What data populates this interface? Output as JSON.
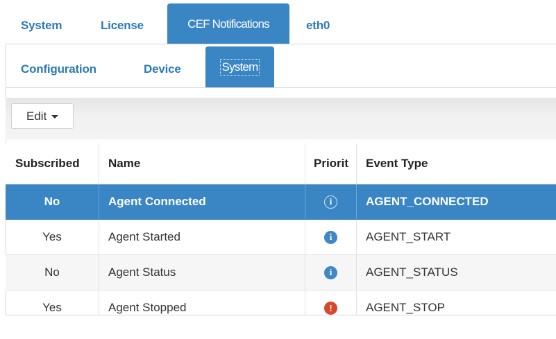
{
  "top_tabs": [
    {
      "label": "System",
      "active": false
    },
    {
      "label": "License",
      "active": false
    },
    {
      "label": "CEF Notifications",
      "active": true
    },
    {
      "label": "eth0",
      "active": false
    }
  ],
  "sub_tabs": [
    {
      "label": "Configuration",
      "active": false
    },
    {
      "label": "Device",
      "active": false
    },
    {
      "label": "System",
      "active": true
    }
  ],
  "toolbar": {
    "edit_label": "Edit"
  },
  "table": {
    "columns": [
      "Subscribed",
      "Name",
      "Priorit",
      "Event Type"
    ],
    "rows": [
      {
        "subscribed": "No",
        "name": "Agent Connected",
        "priority_icon": "info-icon",
        "event_type": "AGENT_CONNECTED",
        "selected": true
      },
      {
        "subscribed": "Yes",
        "name": "Agent Started",
        "priority_icon": "info-icon",
        "event_type": "AGENT_START",
        "selected": false
      },
      {
        "subscribed": "No",
        "name": "Agent Status",
        "priority_icon": "info-icon",
        "event_type": "AGENT_STATUS",
        "selected": false
      },
      {
        "subscribed": "Yes",
        "name": "Agent Stopped",
        "priority_icon": "error-icon",
        "event_type": "AGENT_STOP",
        "selected": false
      }
    ]
  },
  "colors": {
    "accent": "#3a86c4",
    "link": "#2a7ab8",
    "error": "#d9472b"
  }
}
